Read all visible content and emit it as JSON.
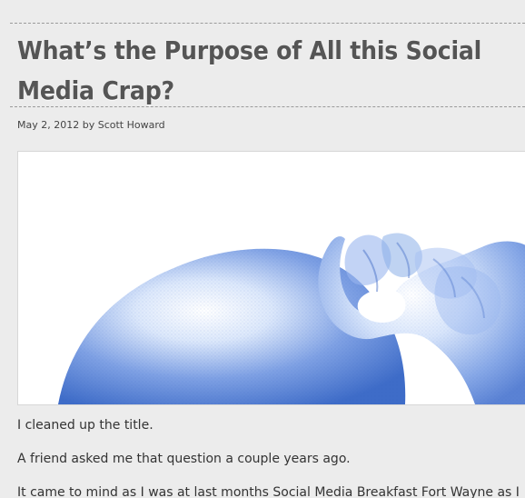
{
  "post": {
    "title": "What’s the Purpose of All this Social Media Crap?",
    "date": "May 2, 2012",
    "byline_prefix": "by",
    "author": "Scott Howard",
    "paragraphs": [
      "I cleaned up the title.",
      "A friend asked me that question a couple years ago.",
      "It came to mind as I was at last months Social Media Breakfast Fort Wayne as I"
    ]
  },
  "image": {
    "subject": "scratching-head-illustration",
    "colors": {
      "ink": "#4d7bcf",
      "light": "#b8cff2"
    }
  }
}
